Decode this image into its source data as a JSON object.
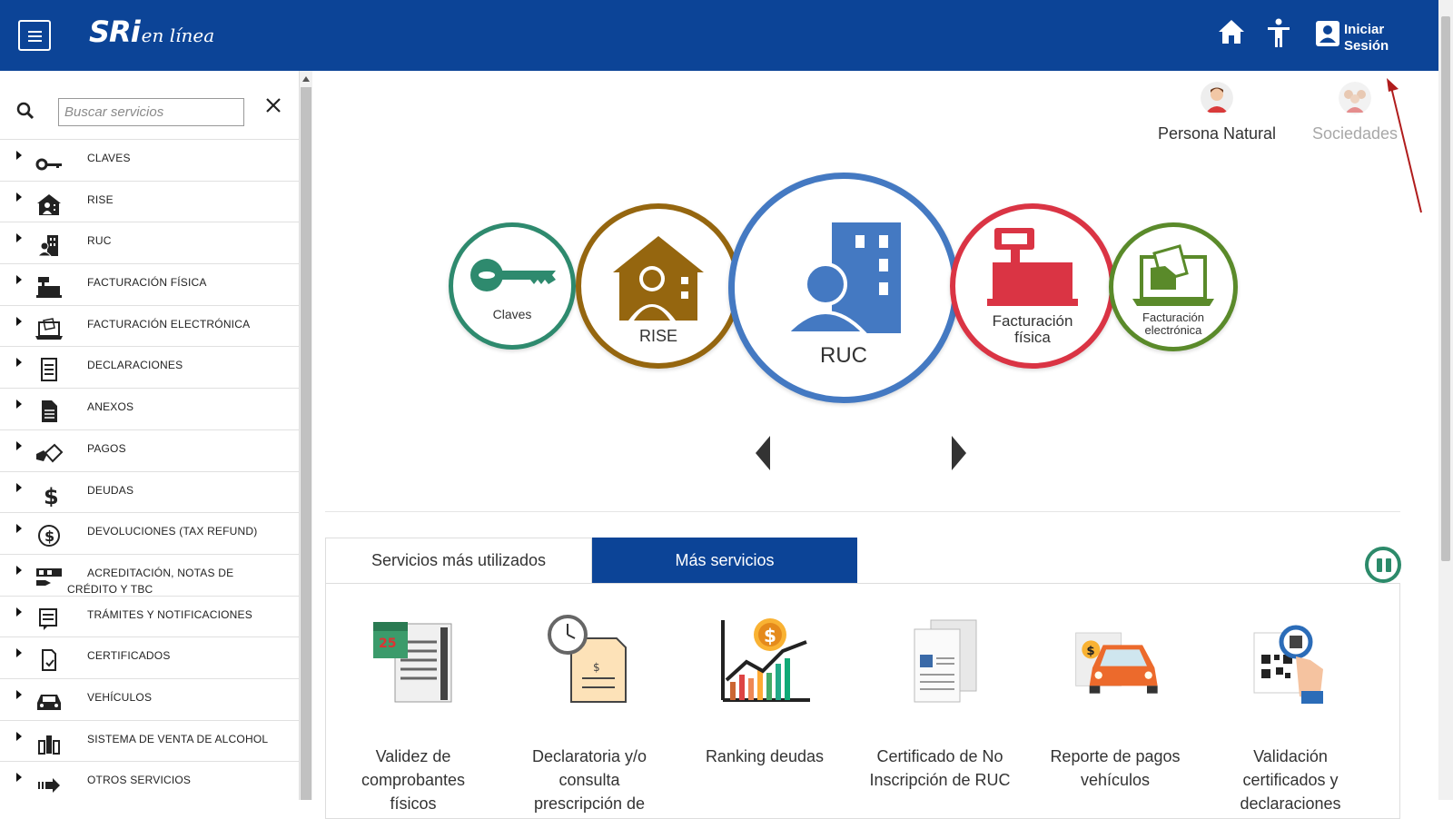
{
  "header": {
    "logo_main": "SRi",
    "logo_sub": "en línea",
    "login_line1": "Iniciar",
    "login_line2": "Sesión"
  },
  "sidebar": {
    "search_placeholder": "Buscar servicios",
    "items": [
      {
        "label": "CLAVES",
        "icon": "key-icon"
      },
      {
        "label": "RISE",
        "icon": "house-person-icon"
      },
      {
        "label": "RUC",
        "icon": "building-person-icon"
      },
      {
        "label": "FACTURACIÓN FÍSICA",
        "icon": "cash-register-icon"
      },
      {
        "label": "FACTURACIÓN ELECTRÓNICA",
        "icon": "laptop-invoice-icon"
      },
      {
        "label": "DECLARACIONES",
        "icon": "document-list-icon"
      },
      {
        "label": "ANEXOS",
        "icon": "document-icon"
      },
      {
        "label": "PAGOS",
        "icon": "hand-card-icon"
      },
      {
        "label": "DEUDAS",
        "icon": "dollar-icon"
      },
      {
        "label": "DEVOLUCIONES (TAX REFUND)",
        "icon": "dollar-circle-icon"
      },
      {
        "label": "ACREDITACIÓN, NOTAS DE CRÉDITO Y TBC",
        "icon": "hand-money-icon"
      },
      {
        "label": "TRÁMITES Y NOTIFICACIONES",
        "icon": "notification-doc-icon"
      },
      {
        "label": "CERTIFICADOS",
        "icon": "certificate-icon"
      },
      {
        "label": "VEHÍCULOS",
        "icon": "car-icon"
      },
      {
        "label": "SISTEMA DE VENTA DE ALCOHOL",
        "icon": "bottles-icon"
      },
      {
        "label": "OTROS SERVICIOS",
        "icon": "arrow-right-icon"
      }
    ]
  },
  "personas": {
    "natural": "Persona Natural",
    "sociedades": "Sociedades"
  },
  "carousel": {
    "claves": "Claves",
    "rise": "RISE",
    "ruc": "RUC",
    "fact_fisica_1": "Facturación",
    "fact_fisica_2": "física",
    "fact_elec_1": "Facturación",
    "fact_elec_2": "electrónica",
    "colors": {
      "claves": "#2e8a6e",
      "rise": "#95660f",
      "ruc": "#4479c2",
      "fisica": "#da3444",
      "electronica": "#5a8a2a"
    }
  },
  "tabs": {
    "tab1": "Servicios más utilizados",
    "tab2": "Más servicios"
  },
  "services": [
    {
      "l1": "Validez de",
      "l2": "comprobantes",
      "l3": "físicos"
    },
    {
      "l1": "Declaratoria y/o",
      "l2": "consulta",
      "l3": "prescripción de"
    },
    {
      "l1": "Ranking deudas",
      "l2": "",
      "l3": ""
    },
    {
      "l1": "Certificado de No",
      "l2": "Inscripción de RUC",
      "l3": ""
    },
    {
      "l1": "Reporte de pagos",
      "l2": "vehículos",
      "l3": ""
    },
    {
      "l1": "Validación",
      "l2": "certificados y",
      "l3": "declaraciones"
    }
  ]
}
